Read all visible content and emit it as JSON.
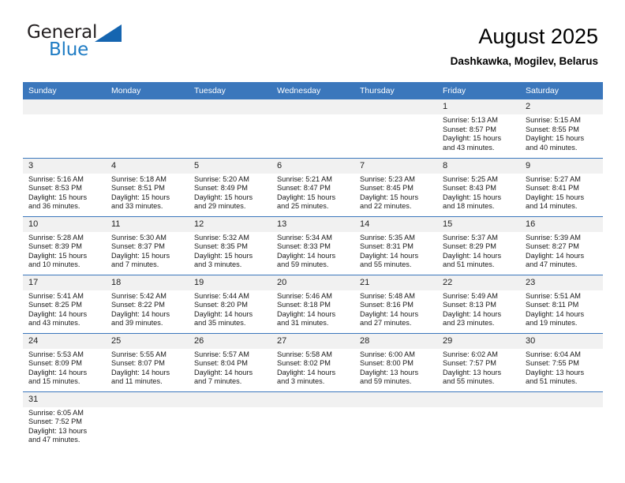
{
  "logo": {
    "word_one": "General",
    "word_two": "Blue",
    "flag_icon": "blue-triangle-flag"
  },
  "header": {
    "title": "August 2025",
    "subtitle": "Dashkawka, Mogilev, Belarus"
  },
  "colors": {
    "header_blue": "#3b77bc",
    "daynum_gray": "#f1f1f1",
    "logo_blue": "#1f7cc4",
    "text": "#000000"
  },
  "calendar": {
    "weekday_headers": [
      "Sunday",
      "Monday",
      "Tuesday",
      "Wednesday",
      "Thursday",
      "Friday",
      "Saturday"
    ],
    "weeks": [
      [
        {
          "day": "",
          "blank": true
        },
        {
          "day": "",
          "blank": true
        },
        {
          "day": "",
          "blank": true
        },
        {
          "day": "",
          "blank": true
        },
        {
          "day": "",
          "blank": true
        },
        {
          "day": "1",
          "sunrise": "Sunrise: 5:13 AM",
          "sunset": "Sunset: 8:57 PM",
          "daylight_line1": "Daylight: 15 hours",
          "daylight_line2": "and 43 minutes."
        },
        {
          "day": "2",
          "sunrise": "Sunrise: 5:15 AM",
          "sunset": "Sunset: 8:55 PM",
          "daylight_line1": "Daylight: 15 hours",
          "daylight_line2": "and 40 minutes."
        }
      ],
      [
        {
          "day": "3",
          "sunrise": "Sunrise: 5:16 AM",
          "sunset": "Sunset: 8:53 PM",
          "daylight_line1": "Daylight: 15 hours",
          "daylight_line2": "and 36 minutes."
        },
        {
          "day": "4",
          "sunrise": "Sunrise: 5:18 AM",
          "sunset": "Sunset: 8:51 PM",
          "daylight_line1": "Daylight: 15 hours",
          "daylight_line2": "and 33 minutes."
        },
        {
          "day": "5",
          "sunrise": "Sunrise: 5:20 AM",
          "sunset": "Sunset: 8:49 PM",
          "daylight_line1": "Daylight: 15 hours",
          "daylight_line2": "and 29 minutes."
        },
        {
          "day": "6",
          "sunrise": "Sunrise: 5:21 AM",
          "sunset": "Sunset: 8:47 PM",
          "daylight_line1": "Daylight: 15 hours",
          "daylight_line2": "and 25 minutes."
        },
        {
          "day": "7",
          "sunrise": "Sunrise: 5:23 AM",
          "sunset": "Sunset: 8:45 PM",
          "daylight_line1": "Daylight: 15 hours",
          "daylight_line2": "and 22 minutes."
        },
        {
          "day": "8",
          "sunrise": "Sunrise: 5:25 AM",
          "sunset": "Sunset: 8:43 PM",
          "daylight_line1": "Daylight: 15 hours",
          "daylight_line2": "and 18 minutes."
        },
        {
          "day": "9",
          "sunrise": "Sunrise: 5:27 AM",
          "sunset": "Sunset: 8:41 PM",
          "daylight_line1": "Daylight: 15 hours",
          "daylight_line2": "and 14 minutes."
        }
      ],
      [
        {
          "day": "10",
          "sunrise": "Sunrise: 5:28 AM",
          "sunset": "Sunset: 8:39 PM",
          "daylight_line1": "Daylight: 15 hours",
          "daylight_line2": "and 10 minutes."
        },
        {
          "day": "11",
          "sunrise": "Sunrise: 5:30 AM",
          "sunset": "Sunset: 8:37 PM",
          "daylight_line1": "Daylight: 15 hours",
          "daylight_line2": "and 7 minutes."
        },
        {
          "day": "12",
          "sunrise": "Sunrise: 5:32 AM",
          "sunset": "Sunset: 8:35 PM",
          "daylight_line1": "Daylight: 15 hours",
          "daylight_line2": "and 3 minutes."
        },
        {
          "day": "13",
          "sunrise": "Sunrise: 5:34 AM",
          "sunset": "Sunset: 8:33 PM",
          "daylight_line1": "Daylight: 14 hours",
          "daylight_line2": "and 59 minutes."
        },
        {
          "day": "14",
          "sunrise": "Sunrise: 5:35 AM",
          "sunset": "Sunset: 8:31 PM",
          "daylight_line1": "Daylight: 14 hours",
          "daylight_line2": "and 55 minutes."
        },
        {
          "day": "15",
          "sunrise": "Sunrise: 5:37 AM",
          "sunset": "Sunset: 8:29 PM",
          "daylight_line1": "Daylight: 14 hours",
          "daylight_line2": "and 51 minutes."
        },
        {
          "day": "16",
          "sunrise": "Sunrise: 5:39 AM",
          "sunset": "Sunset: 8:27 PM",
          "daylight_line1": "Daylight: 14 hours",
          "daylight_line2": "and 47 minutes."
        }
      ],
      [
        {
          "day": "17",
          "sunrise": "Sunrise: 5:41 AM",
          "sunset": "Sunset: 8:25 PM",
          "daylight_line1": "Daylight: 14 hours",
          "daylight_line2": "and 43 minutes."
        },
        {
          "day": "18",
          "sunrise": "Sunrise: 5:42 AM",
          "sunset": "Sunset: 8:22 PM",
          "daylight_line1": "Daylight: 14 hours",
          "daylight_line2": "and 39 minutes."
        },
        {
          "day": "19",
          "sunrise": "Sunrise: 5:44 AM",
          "sunset": "Sunset: 8:20 PM",
          "daylight_line1": "Daylight: 14 hours",
          "daylight_line2": "and 35 minutes."
        },
        {
          "day": "20",
          "sunrise": "Sunrise: 5:46 AM",
          "sunset": "Sunset: 8:18 PM",
          "daylight_line1": "Daylight: 14 hours",
          "daylight_line2": "and 31 minutes."
        },
        {
          "day": "21",
          "sunrise": "Sunrise: 5:48 AM",
          "sunset": "Sunset: 8:16 PM",
          "daylight_line1": "Daylight: 14 hours",
          "daylight_line2": "and 27 minutes."
        },
        {
          "day": "22",
          "sunrise": "Sunrise: 5:49 AM",
          "sunset": "Sunset: 8:13 PM",
          "daylight_line1": "Daylight: 14 hours",
          "daylight_line2": "and 23 minutes."
        },
        {
          "day": "23",
          "sunrise": "Sunrise: 5:51 AM",
          "sunset": "Sunset: 8:11 PM",
          "daylight_line1": "Daylight: 14 hours",
          "daylight_line2": "and 19 minutes."
        }
      ],
      [
        {
          "day": "24",
          "sunrise": "Sunrise: 5:53 AM",
          "sunset": "Sunset: 8:09 PM",
          "daylight_line1": "Daylight: 14 hours",
          "daylight_line2": "and 15 minutes."
        },
        {
          "day": "25",
          "sunrise": "Sunrise: 5:55 AM",
          "sunset": "Sunset: 8:07 PM",
          "daylight_line1": "Daylight: 14 hours",
          "daylight_line2": "and 11 minutes."
        },
        {
          "day": "26",
          "sunrise": "Sunrise: 5:57 AM",
          "sunset": "Sunset: 8:04 PM",
          "daylight_line1": "Daylight: 14 hours",
          "daylight_line2": "and 7 minutes."
        },
        {
          "day": "27",
          "sunrise": "Sunrise: 5:58 AM",
          "sunset": "Sunset: 8:02 PM",
          "daylight_line1": "Daylight: 14 hours",
          "daylight_line2": "and 3 minutes."
        },
        {
          "day": "28",
          "sunrise": "Sunrise: 6:00 AM",
          "sunset": "Sunset: 8:00 PM",
          "daylight_line1": "Daylight: 13 hours",
          "daylight_line2": "and 59 minutes."
        },
        {
          "day": "29",
          "sunrise": "Sunrise: 6:02 AM",
          "sunset": "Sunset: 7:57 PM",
          "daylight_line1": "Daylight: 13 hours",
          "daylight_line2": "and 55 minutes."
        },
        {
          "day": "30",
          "sunrise": "Sunrise: 6:04 AM",
          "sunset": "Sunset: 7:55 PM",
          "daylight_line1": "Daylight: 13 hours",
          "daylight_line2": "and 51 minutes."
        }
      ],
      [
        {
          "day": "31",
          "sunrise": "Sunrise: 6:05 AM",
          "sunset": "Sunset: 7:52 PM",
          "daylight_line1": "Daylight: 13 hours",
          "daylight_line2": "and 47 minutes."
        },
        {
          "day": "",
          "blank": true
        },
        {
          "day": "",
          "blank": true
        },
        {
          "day": "",
          "blank": true
        },
        {
          "day": "",
          "blank": true
        },
        {
          "day": "",
          "blank": true
        },
        {
          "day": "",
          "blank": true
        }
      ]
    ]
  }
}
